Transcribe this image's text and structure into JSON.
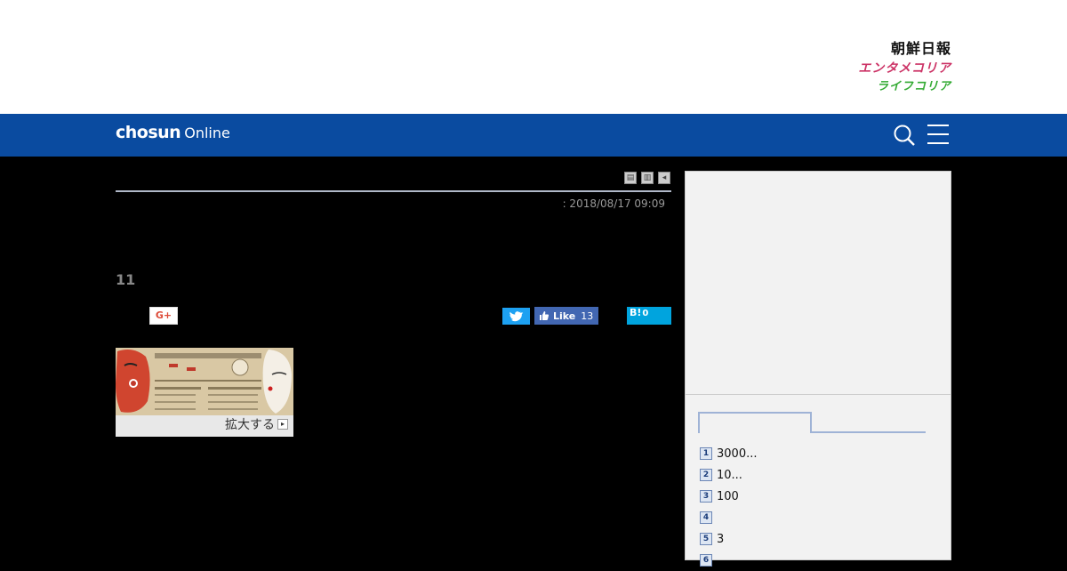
{
  "brands": {
    "chosun": "朝鮮日報",
    "enta": "エンタメコリア",
    "life": "ライフコリア"
  },
  "nav": {
    "logo_bold": "chosun",
    "logo_thin": "Online"
  },
  "article": {
    "date": ": 2018/08/17 09:09",
    "lead_number": "11",
    "tool_icons": [
      "print-icon",
      "font-size-icon",
      "back-icon"
    ]
  },
  "share": {
    "gplus_label": "G+",
    "fb_label": "Like",
    "fb_count": "13",
    "hatena_label": "B!",
    "hatena_count": "0"
  },
  "figure": {
    "expand_label": "拡大する"
  },
  "ranking": {
    "items": [
      {
        "num": "1",
        "text": "3000..."
      },
      {
        "num": "2",
        "text": "10..."
      },
      {
        "num": "3",
        "text": "100"
      },
      {
        "num": "4",
        "text": ""
      },
      {
        "num": "5",
        "text": "3"
      },
      {
        "num": "6",
        "text": ""
      }
    ]
  },
  "colors": {
    "navbar": "#0a4ba0",
    "twitter": "#1da1f2",
    "facebook": "#4267b2",
    "hatena": "#00a4de"
  }
}
